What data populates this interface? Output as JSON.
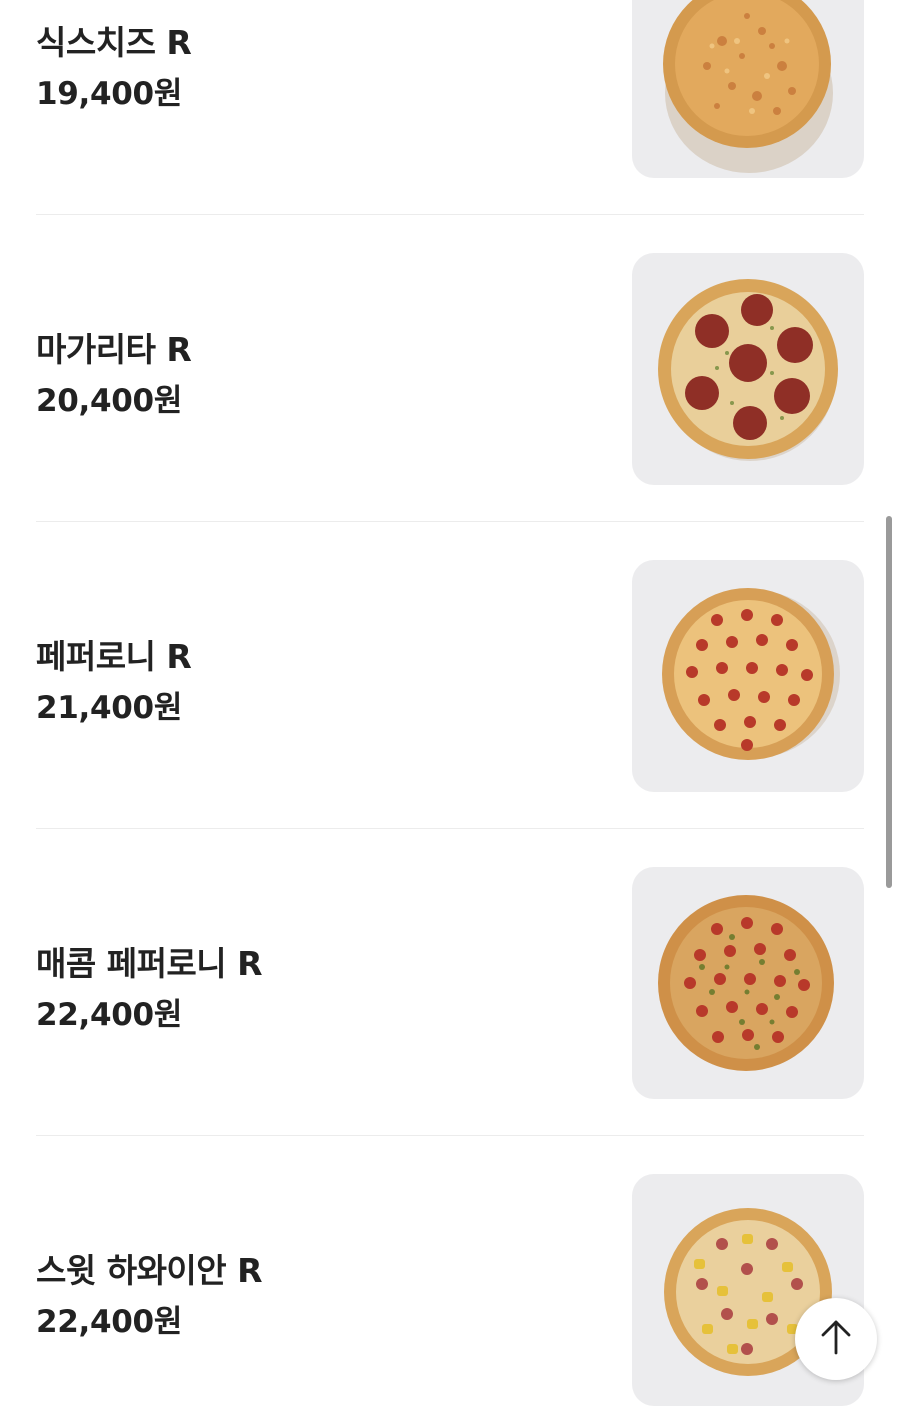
{
  "menu": {
    "items": [
      {
        "name": "식스치즈 R",
        "price": "19,400원",
        "image": "six-cheese-pizza"
      },
      {
        "name": "마가리타 R",
        "price": "20,400원",
        "image": "margherita-pizza"
      },
      {
        "name": "페퍼로니 R",
        "price": "21,400원",
        "image": "pepperoni-pizza"
      },
      {
        "name": "매콤 페퍼로니 R",
        "price": "22,400원",
        "image": "spicy-pepperoni-pizza"
      },
      {
        "name": "스윗 하와이안 R",
        "price": "22,400원",
        "image": "sweet-hawaiian-pizza"
      }
    ]
  },
  "scroll_to_top": {
    "icon": "arrow-up-icon"
  },
  "colors": {
    "text": "#222222",
    "thumb_bg": "#ececee",
    "divider": "#ececec",
    "crust": "#d9a55a",
    "cheese": "#e8b86a",
    "pepperoni": "#b8392a",
    "salami": "#8f2f26",
    "pineapple": "#e6c13a"
  }
}
